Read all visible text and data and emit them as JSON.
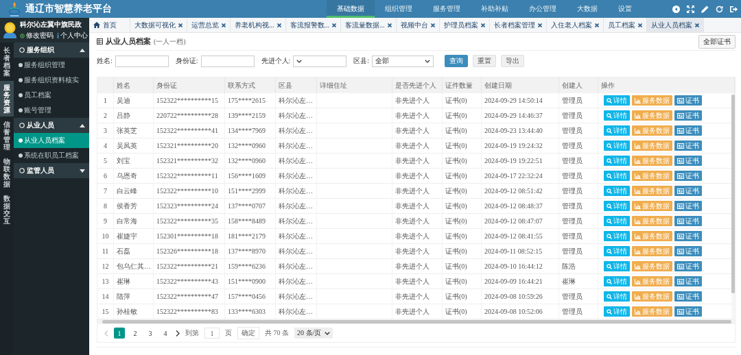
{
  "header": {
    "title": "通辽市智慧养老平台",
    "nav": [
      {
        "label": "基础数据",
        "selected": true
      },
      {
        "label": "组织管理",
        "selected": false
      },
      {
        "label": "服务管理",
        "selected": false
      },
      {
        "label": "补助补贴",
        "selected": false
      },
      {
        "label": "办公管理",
        "selected": false
      },
      {
        "label": "大数据",
        "selected": false
      },
      {
        "label": "设置",
        "selected": false
      }
    ]
  },
  "user": {
    "name": "科尔沁左翼中旗民政",
    "links": [
      {
        "kind": "password",
        "label": "修改密码"
      },
      {
        "kind": "profile",
        "label": "个人中心"
      }
    ]
  },
  "rail": [
    {
      "label": "长者档案",
      "selected": false
    },
    {
      "label": "服务资源",
      "selected": true
    },
    {
      "label": "信誉管理",
      "selected": false
    },
    {
      "label": "物联数据",
      "selected": false
    },
    {
      "label": "数据交互",
      "selected": false
    }
  ],
  "menu": [
    {
      "label": "服务组织",
      "expanded": true,
      "children": [
        {
          "label": "服务组织管理",
          "selected": false
        },
        {
          "label": "服务组织资料核实",
          "selected": false
        },
        {
          "label": "员工档案",
          "selected": false
        },
        {
          "label": "账号管理",
          "selected": false
        }
      ]
    },
    {
      "label": "从业人员",
      "expanded": true,
      "children": [
        {
          "label": "从业人员档案",
          "selected": true
        },
        {
          "label": "系统在职员工档案",
          "selected": false
        }
      ]
    },
    {
      "label": "监管人员",
      "expanded": false
    }
  ],
  "tabs": [
    {
      "kind": "home",
      "label": "首页",
      "selected": false
    },
    {
      "kind": "page",
      "label": "大数据可视化",
      "selected": false
    },
    {
      "kind": "page",
      "label": "运营总览",
      "selected": false
    },
    {
      "kind": "page",
      "label": "养老机构视...",
      "selected": false
    },
    {
      "kind": "page",
      "label": "客流报警数...",
      "selected": false
    },
    {
      "kind": "page",
      "label": "客流量数据...",
      "selected": false
    },
    {
      "kind": "page",
      "label": "视频中台",
      "selected": false
    },
    {
      "kind": "page",
      "label": "护理员档案",
      "selected": false
    },
    {
      "kind": "page",
      "label": "长者档案管理",
      "selected": false
    },
    {
      "kind": "page",
      "label": "入住老人档案",
      "selected": false
    },
    {
      "kind": "page",
      "label": "员工档案",
      "selected": false
    },
    {
      "kind": "page",
      "label": "从业人员档案",
      "selected": true
    }
  ],
  "page": {
    "title": "从业人员档案",
    "subtitle": "(一人一档)",
    "action": "全部证书"
  },
  "filters": [
    {
      "kind": "input",
      "label": "姓名:"
    },
    {
      "kind": "input",
      "label": "身份证:"
    },
    {
      "kind": "select",
      "label": "先进个人:"
    },
    {
      "kind": "select",
      "label": "区县:",
      "value": "全部"
    }
  ],
  "filter_buttons": [
    {
      "kind": "search",
      "label": "查询"
    },
    {
      "kind": "reset",
      "label": "重置"
    },
    {
      "kind": "export",
      "label": "导出"
    }
  ],
  "table": {
    "columns": [
      "姓名",
      "身份证",
      "联系方式",
      "区县",
      "详细住址",
      "是否先进个人",
      "证件数量",
      "创建日期",
      "创建人",
      "操作"
    ],
    "rows": [
      {
        "index": "1",
        "name": "吴迪",
        "id_card": "152322**********15",
        "phone": "175****2615",
        "district": "科尔沁左…",
        "advanced": "非先进个人",
        "certificates": "证书(0)",
        "created": "2024-09-29 14:50:14",
        "creator": "管理员",
        "actions": [
          {
            "kind": "detail",
            "label": "详情"
          },
          {
            "kind": "data",
            "label": "服务数据"
          },
          {
            "kind": "certificate",
            "label": "证书"
          }
        ]
      },
      {
        "index": "2",
        "name": "吕静",
        "id_card": "220722**********28",
        "phone": "139****2159",
        "district": "科尔沁左…",
        "advanced": "非先进个人",
        "certificates": "证书(0)",
        "created": "2024-09-29 14:46:37",
        "creator": "管理员",
        "actions": [
          {
            "kind": "detail",
            "label": "详情"
          },
          {
            "kind": "data",
            "label": "服务数据"
          },
          {
            "kind": "certificate",
            "label": "证书"
          }
        ]
      },
      {
        "index": "3",
        "name": "张英芝",
        "id_card": "152322**********41",
        "phone": "134****7969",
        "district": "科尔沁左…",
        "advanced": "非先进个人",
        "certificates": "证书(0)",
        "created": "2024-09-23 13:44:40",
        "creator": "管理员",
        "actions": [
          {
            "kind": "detail",
            "label": "详情"
          },
          {
            "kind": "data",
            "label": "服务数据"
          },
          {
            "kind": "certificate",
            "label": "证书"
          }
        ]
      },
      {
        "index": "4",
        "name": "吴凤英",
        "id_card": "152321**********20",
        "phone": "132****0960",
        "district": "科尔沁左…",
        "advanced": "非先进个人",
        "certificates": "证书(0)",
        "created": "2024-09-19 19:24:32",
        "creator": "管理员",
        "actions": [
          {
            "kind": "detail",
            "label": "详情"
          },
          {
            "kind": "data",
            "label": "服务数据"
          },
          {
            "kind": "certificate",
            "label": "证书"
          }
        ]
      },
      {
        "index": "5",
        "name": "刘宝",
        "id_card": "152321**********32",
        "phone": "132****0960",
        "district": "科尔沁左…",
        "advanced": "非先进个人",
        "certificates": "证书(0)",
        "created": "2024-09-19 19:22:51",
        "creator": "管理员",
        "actions": [
          {
            "kind": "detail",
            "label": "详情"
          },
          {
            "kind": "data",
            "label": "服务数据"
          },
          {
            "kind": "certificate",
            "label": "证书"
          }
        ]
      },
      {
        "index": "6",
        "name": "乌恩奇",
        "id_card": "152322**********11",
        "phone": "156****1609",
        "district": "科尔沁左…",
        "advanced": "非先进个人",
        "certificates": "证书(0)",
        "created": "2024-09-17 22:32:24",
        "creator": "管理员",
        "actions": [
          {
            "kind": "detail",
            "label": "详情"
          },
          {
            "kind": "data",
            "label": "服务数据"
          },
          {
            "kind": "certificate",
            "label": "证书"
          }
        ]
      },
      {
        "index": "7",
        "name": "白云峰",
        "id_card": "152322**********10",
        "phone": "151****2999",
        "district": "科尔沁左…",
        "advanced": "非先进个人",
        "certificates": "证书(0)",
        "created": "2024-09-12 08:51:42",
        "creator": "管理员",
        "actions": [
          {
            "kind": "detail",
            "label": "详情"
          },
          {
            "kind": "data",
            "label": "服务数据"
          },
          {
            "kind": "certificate",
            "label": "证书"
          }
        ]
      },
      {
        "index": "8",
        "name": "侯香芳",
        "id_card": "152323**********24",
        "phone": "137****0707",
        "district": "科尔沁左…",
        "advanced": "非先进个人",
        "certificates": "证书(0)",
        "created": "2024-09-12 08:48:37",
        "creator": "管理员",
        "actions": [
          {
            "kind": "detail",
            "label": "详情"
          },
          {
            "kind": "data",
            "label": "服务数据"
          },
          {
            "kind": "certificate",
            "label": "证书"
          }
        ]
      },
      {
        "index": "9",
        "name": "白常海",
        "id_card": "152322**********35",
        "phone": "158****8489",
        "district": "科尔沁左…",
        "advanced": "非先进个人",
        "certificates": "证书(0)",
        "created": "2024-09-12 08:47:07",
        "creator": "管理员",
        "actions": [
          {
            "kind": "detail",
            "label": "详情"
          },
          {
            "kind": "data",
            "label": "服务数据"
          },
          {
            "kind": "certificate",
            "label": "证书"
          }
        ]
      },
      {
        "index": "10",
        "name": "崔婕宇",
        "id_card": "152301**********18",
        "phone": "181****2179",
        "district": "科尔沁左…",
        "advanced": "非先进个人",
        "certificates": "证书(0)",
        "created": "2024-09-12 08:41:55",
        "creator": "管理员",
        "actions": [
          {
            "kind": "detail",
            "label": "详情"
          },
          {
            "kind": "data",
            "label": "服务数据"
          },
          {
            "kind": "certificate",
            "label": "证书"
          }
        ]
      },
      {
        "index": "11",
        "name": "石磊",
        "id_card": "152326**********18",
        "phone": "137****8970",
        "district": "科尔沁左…",
        "advanced": "非先进个人",
        "certificates": "证书(0)",
        "created": "2024-09-11 08:52:15",
        "creator": "管理员",
        "actions": [
          {
            "kind": "detail",
            "label": "详情"
          },
          {
            "kind": "data",
            "label": "服务数据"
          },
          {
            "kind": "certificate",
            "label": "证书"
          }
        ]
      },
      {
        "index": "12",
        "name": "包乌仁其…",
        "id_card": "152322**********21",
        "phone": "159****6236",
        "district": "科尔沁左…",
        "advanced": "非先进个人",
        "certificates": "证书(0)",
        "created": "2024-09-10 16:44:12",
        "creator": "陈浩",
        "actions": [
          {
            "kind": "detail",
            "label": "详情"
          },
          {
            "kind": "data",
            "label": "服务数据"
          },
          {
            "kind": "certificate",
            "label": "证书"
          }
        ]
      },
      {
        "index": "13",
        "name": "崔琳",
        "id_card": "152322**********43",
        "phone": "151****0900",
        "district": "科尔沁左…",
        "advanced": "非先进个人",
        "certificates": "证书(0)",
        "created": "2024-09-09 16:44:21",
        "creator": "崔琳",
        "actions": [
          {
            "kind": "detail",
            "label": "详情"
          },
          {
            "kind": "data",
            "label": "服务数据"
          },
          {
            "kind": "certificate",
            "label": "证书"
          }
        ]
      },
      {
        "index": "14",
        "name": "陆萍",
        "id_card": "152322**********47",
        "phone": "157****0456",
        "district": "科尔沁左…",
        "advanced": "非先进个人",
        "certificates": "证书(0)",
        "created": "2024-09-08 10:59:26",
        "creator": "管理员",
        "actions": [
          {
            "kind": "detail",
            "label": "详情"
          },
          {
            "kind": "data",
            "label": "服务数据"
          },
          {
            "kind": "certificate",
            "label": "证书"
          }
        ]
      },
      {
        "index": "15",
        "name": "孙桂敏",
        "id_card": "152322**********83",
        "phone": "133****6303",
        "district": "科尔沁左…",
        "advanced": "非先进个人",
        "certificates": "证书(0)",
        "created": "2024-09-08 10:52:06",
        "creator": "管理员",
        "actions": [
          {
            "kind": "detail",
            "label": "详情"
          },
          {
            "kind": "data",
            "label": "服务数据"
          },
          {
            "kind": "certificate",
            "label": "证书"
          }
        ]
      }
    ]
  },
  "pagination": {
    "prev": {
      "disabled": true
    },
    "pages": [
      {
        "label": "1",
        "selected": true
      },
      {
        "label": "2",
        "selected": false
      },
      {
        "label": "3",
        "selected": false
      },
      {
        "label": "4",
        "selected": false
      }
    ],
    "next": {
      "disabled": false
    },
    "goto_label": "到第",
    "goto_value": "1",
    "page_unit": "页",
    "confirm": "确定",
    "total": "共 70 条",
    "page_size": "20 条/页"
  }
}
